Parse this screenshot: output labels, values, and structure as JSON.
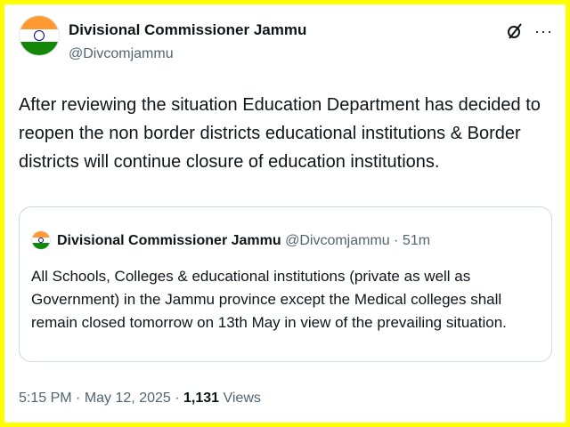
{
  "tweet": {
    "author_name": "Divisional Commissioner Jammu",
    "author_handle": "@Divcomjammu",
    "text": "After reviewing the situation Education Department has decided to reopen the non border districts educational institutions & Border districts will continue closure of education institutions.",
    "header_icons": [
      "grok-icon",
      "more-icon"
    ],
    "more_glyph": "···",
    "avatar_icon": "india-flag",
    "time": "5:15 PM",
    "date": "May 12, 2025",
    "views_count": "1,131",
    "views_label": "Views",
    "separator": "·"
  },
  "quote": {
    "author_name": "Divisional Commissioner Jammu",
    "author_handle": "@Divcomjammu",
    "separator": "·",
    "relative_time": "51m",
    "avatar_icon": "india-flag",
    "text": "All Schools, Colleges & educational institutions (private as well as Government) in the Jammu province except the Medical colleges shall remain closed tomorrow on 13th May in view of the prevailing situation."
  },
  "colors": {
    "frame": "#ffff00",
    "text_primary": "#0f1419",
    "text_secondary": "#536471",
    "border": "#cfd9de"
  }
}
